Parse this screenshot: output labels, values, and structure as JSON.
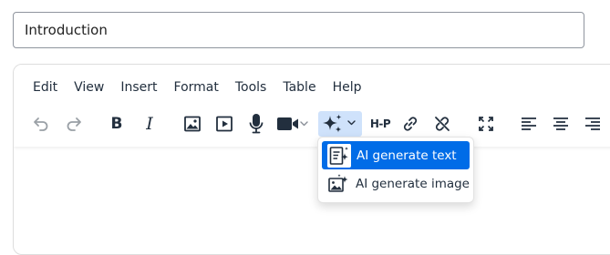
{
  "title_field": {
    "value": "Introduction"
  },
  "menubar": {
    "items": [
      "Edit",
      "View",
      "Insert",
      "Format",
      "Tools",
      "Table",
      "Help"
    ]
  },
  "toolbar": {
    "bold_label": "B",
    "italic_label": "I",
    "h5p_label": "H-P",
    "icons": [
      "undo-icon",
      "redo-icon",
      "bold-icon",
      "italic-icon",
      "image-icon",
      "media-icon",
      "microphone-icon",
      "video-camera-icon",
      "ai-sparkle-icon",
      "h5p-icon",
      "link-icon",
      "unlink-icon",
      "fullscreen-icon",
      "align-left-icon",
      "align-center-icon",
      "align-right-icon"
    ]
  },
  "ai_dropdown": {
    "items": [
      {
        "label": "AI generate text",
        "icon": "ai-text-icon",
        "selected": true
      },
      {
        "label": "AI generate image",
        "icon": "ai-image-icon",
        "selected": false
      }
    ]
  },
  "colors": {
    "accent": "#006ce7",
    "active_button": "#cfe2fb",
    "icon": "#222f3e",
    "disabled_icon": "#9aa0a6"
  }
}
